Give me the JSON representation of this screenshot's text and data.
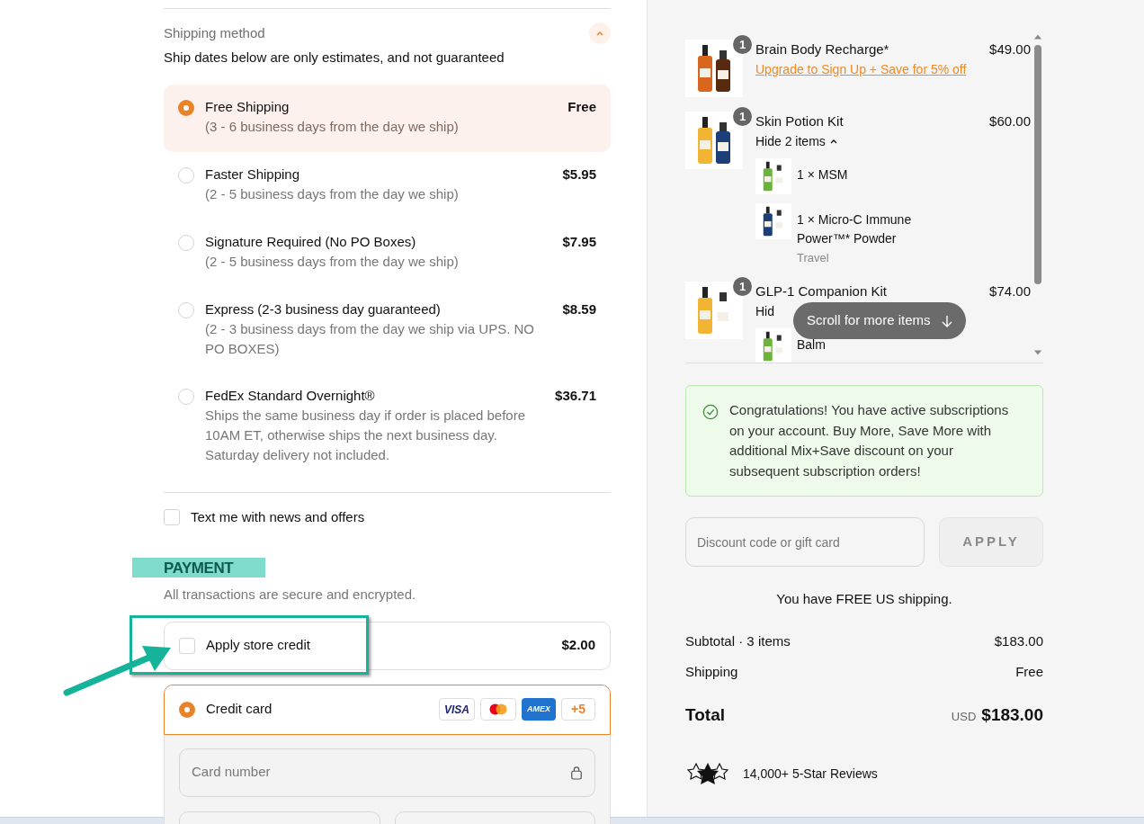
{
  "shipping": {
    "title": "Shipping method",
    "expanded": true,
    "note": "Ship dates below are only estimates, and not guaranteed",
    "options": [
      {
        "name": "Free Shipping",
        "detail": "(3 - 6 business days from the day we ship)",
        "price": "Free",
        "selected": true
      },
      {
        "name": "Faster Shipping",
        "detail": "(2 - 5 business days from the day we ship)",
        "price": "$5.95",
        "selected": false
      },
      {
        "name": "Signature Required (No PO Boxes)",
        "detail": "(2 - 5 business days from the day we ship)",
        "price": "$7.95",
        "selected": false
      },
      {
        "name": "Express (2-3 business day guaranteed)",
        "detail": "(2 - 3 business days from the day we ship via UPS. NO PO BOXES)",
        "price": "$8.59",
        "selected": false
      },
      {
        "name": "FedEx Standard Overnight®",
        "detail": "Ships the same business day if order is placed before 10AM ET, otherwise ships the next business day. Saturday delivery not included.",
        "price": "$36.71",
        "selected": false
      }
    ]
  },
  "sms_opt_in": {
    "label": "Text me with news and offers",
    "checked": false
  },
  "payment": {
    "title": "PAYMENT",
    "subtitle": "All transactions are secure and encrypted.",
    "store_credit": {
      "label": "Apply store credit",
      "amount": "$2.00",
      "checked": false
    },
    "methods": [
      {
        "label": "Credit card",
        "selected": true,
        "brands": [
          {
            "kind": "visa",
            "label": "VISA"
          },
          {
            "kind": "mastercard"
          },
          {
            "kind": "amex",
            "label": "AMEX"
          },
          {
            "kind": "more",
            "label": "+5"
          }
        ]
      }
    ],
    "card_number": {
      "placeholder": "Card number"
    }
  },
  "cart": {
    "items": [
      {
        "name": "Brain Body Recharge*",
        "price": "$49.00",
        "quantity": "1",
        "link": "Upgrade to Sign Up + Save for 5% off"
      },
      {
        "name": "Skin Potion Kit",
        "price": "$60.00",
        "quantity": "1",
        "toggle": "Hide 2 items",
        "expanded": true,
        "children": [
          {
            "name": "1 × MSM"
          },
          {
            "name": "1 × Micro-C Immune Power™* Powder",
            "variant": "Travel"
          }
        ]
      },
      {
        "name": "GLP-1 Companion Kit",
        "price": "$74.00",
        "quantity": "1",
        "toggle": "Hid",
        "children": [
          {
            "name": "Balm"
          }
        ]
      }
    ],
    "scroll_hint": "Scroll for more items"
  },
  "notice": "Congratulations! You have active subscriptions on your account. Buy More, Save More with additional Mix+Save discount on your subsequent subscription orders!",
  "discount": {
    "placeholder": "Discount code or gift card",
    "button": "APPLY"
  },
  "free_shipping_note": "You have FREE US shipping.",
  "summary": {
    "rows": [
      {
        "label": "Subtotal · 3 items",
        "value": "$183.00"
      },
      {
        "label": "Shipping",
        "value": "Free"
      }
    ],
    "total_label": "Total",
    "currency": "USD",
    "total": "$183.00"
  },
  "reviews": "14,000+ 5-Star Reviews"
}
